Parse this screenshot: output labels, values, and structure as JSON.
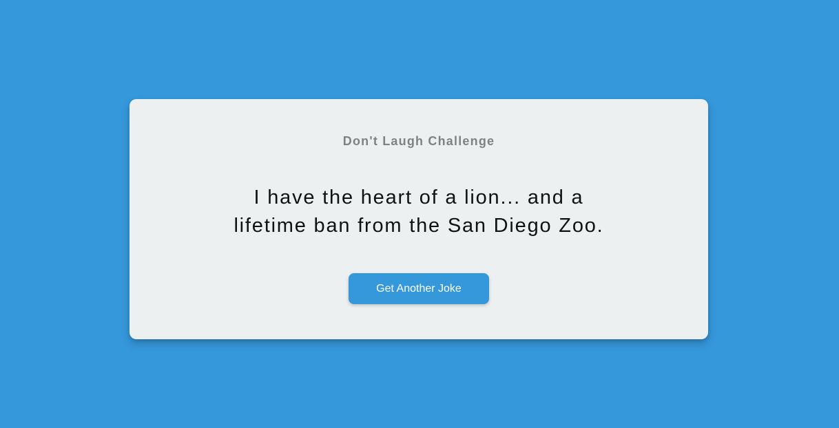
{
  "colors": {
    "background": "#3598db",
    "card": "#ecf0f1",
    "accent": "#3598db",
    "heading_text": "#7f8282",
    "joke_text": "#111111"
  },
  "card": {
    "title": "Don't Laugh Challenge",
    "joke": "I have the heart of a lion... and a lifetime ban from the San Diego Zoo.",
    "button_label": "Get Another Joke"
  }
}
